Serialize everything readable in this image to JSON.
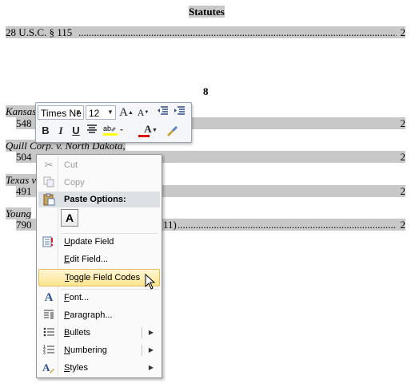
{
  "document": {
    "statutes_heading": "Statutes",
    "statute_entry": "28 U.S.C. § 115",
    "statute_page": "2",
    "section_number": "8",
    "cases": [
      {
        "name": "Kansas",
        "cite": "548",
        "page": "2"
      },
      {
        "name": "Quill Corp. v. North Dakota,",
        "cite": "504",
        "page": "2"
      },
      {
        "name": "Texas v",
        "cite": "491",
        "page": "2"
      },
      {
        "name": "Young",
        "cite": "790",
        "cite_tail": "11)",
        "page": "2"
      }
    ]
  },
  "mini_toolbar": {
    "font_name": "Times Ne",
    "font_size": "12",
    "buttons": [
      "grow-font",
      "shrink-font",
      "decrease-indent",
      "increase-indent",
      "bold",
      "italic",
      "underline",
      "center",
      "highlight",
      "font-color",
      "format-painter"
    ],
    "bold_label": "B",
    "italic_label": "I",
    "underline_label": "U",
    "grow_label": "A",
    "shrink_label": "A",
    "font_color_label": "A",
    "font_color": "#e00000",
    "highlight_color": "#ffff00"
  },
  "context_menu": {
    "items": [
      {
        "label": "Cut",
        "enabled": false
      },
      {
        "label": "Copy",
        "enabled": false
      },
      {
        "label": "Paste Options:",
        "type": "header"
      },
      {
        "label": "A",
        "type": "paste-icon"
      },
      {
        "label": "Update Field"
      },
      {
        "label": "Edit Field..."
      },
      {
        "label": "Toggle Field Codes",
        "hover": true
      },
      {
        "label": "Font..."
      },
      {
        "label": "Paragraph..."
      },
      {
        "label": "Bullets",
        "submenu": true
      },
      {
        "label": "Numbering",
        "submenu": true
      },
      {
        "label": "Styles",
        "submenu": true
      }
    ]
  }
}
